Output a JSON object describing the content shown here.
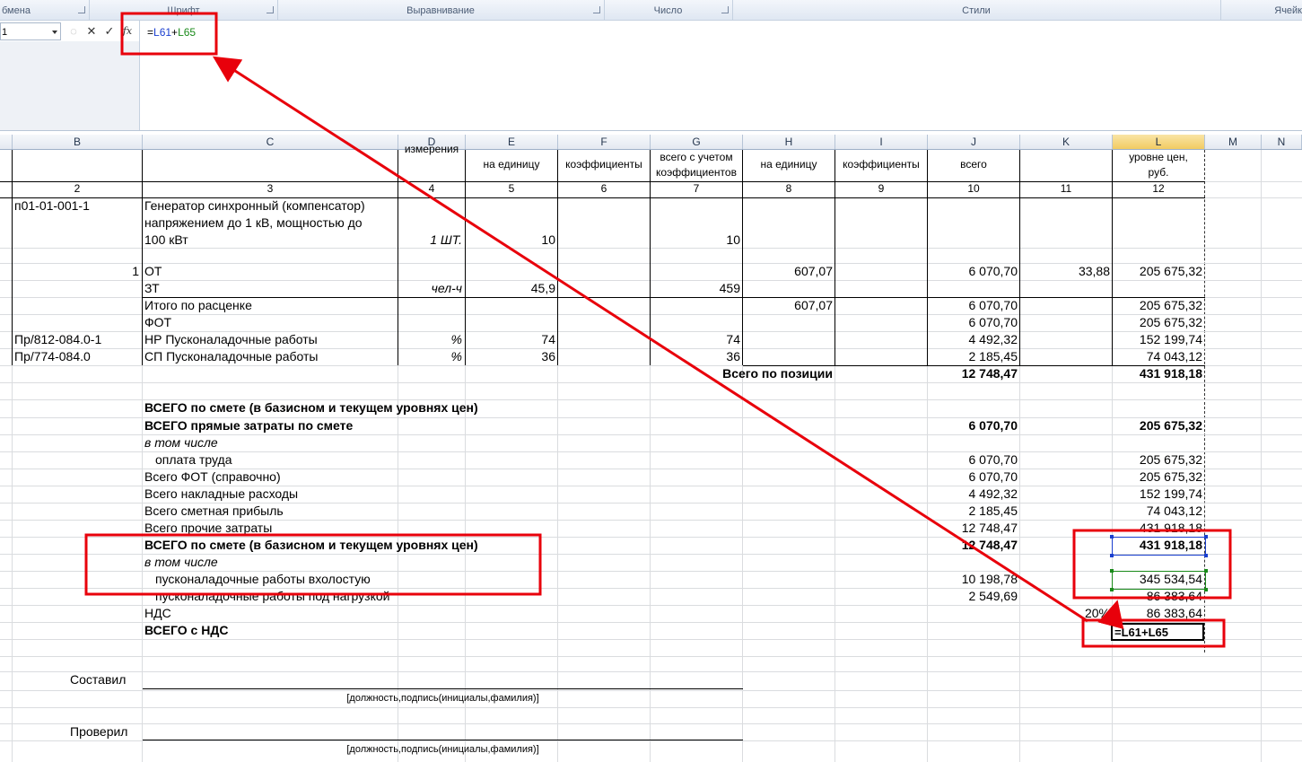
{
  "ribbon": {
    "groups": [
      "бмена",
      "Шрифт",
      "Выравнивание",
      "Число",
      "Стили",
      "Ячейк"
    ]
  },
  "formula_bar": {
    "name_box": "1",
    "formula_prefix": "=",
    "ref1": "L61",
    "plus": "+",
    "ref2": "L65",
    "cancel_icon": "✕",
    "enter_icon": "✓",
    "fx_icon": "fx"
  },
  "columns": [
    "B",
    "C",
    "D",
    "E",
    "F",
    "G",
    "H",
    "I",
    "J",
    "K",
    "L",
    "M",
    "N"
  ],
  "header_row": {
    "d": "измерения",
    "e": "на единицу",
    "f": "коэффициенты",
    "g1": "всего с учетом",
    "g2": "коэффициентов",
    "h": "на единицу",
    "i": "коэффициенты",
    "j": "всего",
    "l1": "уровне цен,",
    "l2": "руб."
  },
  "numbers_row": [
    "2",
    "3",
    "4",
    "5",
    "6",
    "7",
    "8",
    "9",
    "10",
    "11",
    "12"
  ],
  "position": {
    "code": "п01-01-001-1",
    "name1": "Генератор синхронный (компенсатор)",
    "name2": "напряжением до 1 кВ, мощностью до",
    "name3": "100 кВт",
    "unit": "1  ШТ.",
    "qty_e": "10",
    "qty_g": "10"
  },
  "rows": {
    "ot": {
      "num": "1",
      "label": "ОТ",
      "h": "607,07",
      "j": "6 070,70",
      "k": "33,88",
      "l": "205 675,32"
    },
    "zt": {
      "label": "ЗТ",
      "d": "чел-ч",
      "e": "45,9",
      "g": "459"
    },
    "itogo": {
      "label": "Итого по расценке",
      "h": "607,07",
      "j": "6 070,70",
      "l": "205 675,32"
    },
    "fot": {
      "label": "ФОТ",
      "j": "6 070,70",
      "l": "205 675,32"
    },
    "nr": {
      "code": "Пр/812-084.0-1",
      "label": "НР Пусконаладочные работы",
      "d": "%",
      "e": "74",
      "g": "74",
      "j": "4 492,32",
      "l": "152 199,74"
    },
    "sp": {
      "code": "Пр/774-084.0",
      "label": "СП Пусконаладочные работы",
      "d": "%",
      "e": "36",
      "g": "36",
      "j": "2 185,45",
      "l": "74 043,12"
    },
    "total_pos": {
      "label": "Всего по позиции",
      "j": "12 748,47",
      "l": "431 918,18"
    }
  },
  "summary": {
    "title1": "ВСЕГО по смете (в базисном и текущем уровнях цен)",
    "direct": {
      "label": "ВСЕГО прямые затраты по смете",
      "j": "6 070,70",
      "l": "205 675,32"
    },
    "incl1": "в том числе",
    "pay": {
      "label": "оплата труда",
      "j": "6 070,70",
      "l": "205 675,32"
    },
    "fot": {
      "label": "Всего ФОТ (справочно)",
      "j": "6 070,70",
      "l": "205 675,32"
    },
    "overhead": {
      "label": "Всего накладные расходы",
      "j": "4 492,32",
      "l": "152 199,74"
    },
    "profit": {
      "label": "Всего сметная прибыль",
      "j": "2 185,45",
      "l": "74 043,12"
    },
    "other": {
      "label": "Всего прочие затраты",
      "j": "12 748,47",
      "l": "431 918,18"
    },
    "total": {
      "label": "ВСЕГО по смете (в базисном и текущем уровнях цен)",
      "j": "12 748,47",
      "l": "431 918,18"
    },
    "incl2": "в том числе",
    "idle": {
      "label": "пусконаладочные работы вхолостую",
      "j": "10 198,78",
      "l": "345 534,54"
    },
    "load": {
      "label": "пусконаладочные работы под нагрузкой",
      "j": "2 549,69",
      "l": "86 383,64"
    },
    "vat": {
      "label": "НДС",
      "k": "20%",
      "l": "86 383,64"
    },
    "with_vat": {
      "label": "ВСЕГО с НДС",
      "l": "=L61+L65"
    }
  },
  "signatures": {
    "compiled": "Составил",
    "checked": "Проверил",
    "hint1": "[должность,подпись(инициалы,фамилия)]",
    "hint2": "[должность,подпись(инициалы,фамилия)]"
  },
  "colors": {
    "annotation_red": "#e8000b",
    "ref_blue": "#1a3fcf",
    "ref_green": "#1a8a1a",
    "selected_header": "#f2cb62"
  }
}
